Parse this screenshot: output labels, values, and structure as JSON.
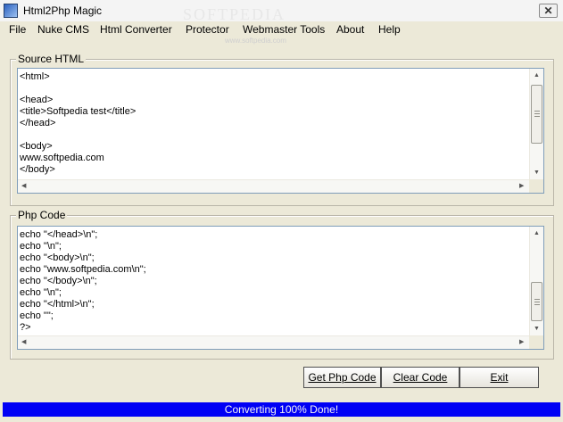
{
  "window": {
    "title": "Html2Php Magic",
    "watermark": "SOFTPEDIA",
    "watermark_sub": "www.softpedia.com"
  },
  "menu": [
    "File",
    "Nuke CMS",
    "Html Converter",
    "Protector",
    "Webmaster Tools",
    "About",
    "Help"
  ],
  "source": {
    "label": "Source HTML",
    "lines": [
      "<html>",
      "",
      "<head>",
      "<title>Softpedia test</title>",
      "</head>",
      "",
      "<body>",
      "www.softpedia.com",
      "</body>"
    ]
  },
  "php": {
    "label": "Php Code",
    "lines": [
      "echo \"</head>\\n\";",
      "echo \"\\n\";",
      "echo \"<body>\\n\";",
      "echo \"www.softpedia.com\\n\";",
      "echo \"</body>\\n\";",
      "echo \"\\n\";",
      "echo \"</html>\\n\";",
      "echo \"\";",
      "?>"
    ]
  },
  "buttons": {
    "get_php": "Get Php Code",
    "clear": "Clear Code",
    "exit": "Exit"
  },
  "status": "Converting 100% Done!",
  "icons": {
    "app": "html2php-app-icon",
    "close": "close-icon"
  }
}
